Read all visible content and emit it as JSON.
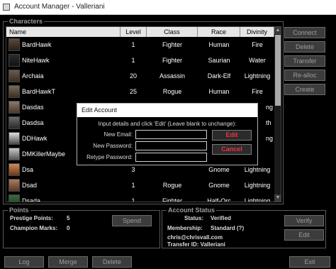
{
  "window": {
    "title": "Account Manager - Valleriani"
  },
  "characters": {
    "group_label": "Characters",
    "columns": [
      "Name",
      "Level",
      "Class",
      "Race",
      "Divinity"
    ],
    "rows": [
      {
        "name": "BardHawk",
        "level": "1",
        "class": "Fighter",
        "race": "Human",
        "divinity": "Fire"
      },
      {
        "name": "NiteHawk",
        "level": "1",
        "class": "Fighter",
        "race": "Saurian",
        "divinity": "Water"
      },
      {
        "name": "Archaia",
        "level": "20",
        "class": "Assassin",
        "race": "Dark-Elf",
        "divinity": "Lightning"
      },
      {
        "name": "BardHawkT",
        "level": "25",
        "class": "Rogue",
        "race": "Human",
        "divinity": "Fire"
      },
      {
        "name": "Dasdas",
        "level": "",
        "class": "",
        "race": "",
        "divinity": ""
      },
      {
        "name": "Dasdsa",
        "level": "",
        "class": "",
        "race": "",
        "divinity": ""
      },
      {
        "name": "DDHawk",
        "level": "",
        "class": "",
        "race": "",
        "divinity": ""
      },
      {
        "name": "DMKillerMaybe",
        "level": "",
        "class": "",
        "race": "",
        "divinity": ""
      },
      {
        "name": "Dsa",
        "level": "",
        "class": "",
        "race": "Gnome",
        "divinity": "Lightning"
      },
      {
        "name": "Dsad",
        "level": "1",
        "class": "Rogue",
        "race": "Gnome",
        "divinity": "Lightning"
      },
      {
        "name": "Dsada",
        "level": "1",
        "class": "Fighter",
        "race": "Half-Orc",
        "divinity": "Lightning"
      }
    ],
    "partial_values": {
      "row4_div": "ng",
      "row5_div": "th",
      "row6_div": "ng",
      "row8_level": "3"
    }
  },
  "side_buttons": {
    "connect": "Connect",
    "delete": "Delete",
    "transfer": "Transfer",
    "realloc": "Re-alloc",
    "create": "Create"
  },
  "points": {
    "group_label": "Points",
    "prestige_label": "Prestige Points:",
    "prestige_value": "5",
    "champion_label": "Champion Marks:",
    "champion_value": "0",
    "spend": "Spend"
  },
  "account_status": {
    "group_label": "Account Status",
    "status_label": "Status:",
    "status_value": "Verified",
    "membership_label": "Membership:",
    "membership_value": "Standard (?)",
    "email": "chris@chrisvall.com",
    "transfer_id": "Transfer ID: Valleriani",
    "verify": "Verify",
    "edit": "Edit"
  },
  "bottom_buttons": {
    "log": "Log",
    "merge": "Merge",
    "delete": "Delete",
    "exit": "Exit"
  },
  "dialog": {
    "title": "Edit Account",
    "instructions": "Input details and click 'Edit' (Leave blank to unchange):",
    "new_email_label": "New Email:",
    "new_email_value": "",
    "new_password_label": "New Password:",
    "new_password_value": "",
    "retype_password_label": "Retype Password:",
    "retype_password_value": "",
    "edit_button": "Edit",
    "cancel_button": "Cancel"
  },
  "colors": {
    "dialog_button_text": "#e34444",
    "header_bg": "#e6e6e6",
    "panel_border": "#5a5a5a"
  }
}
